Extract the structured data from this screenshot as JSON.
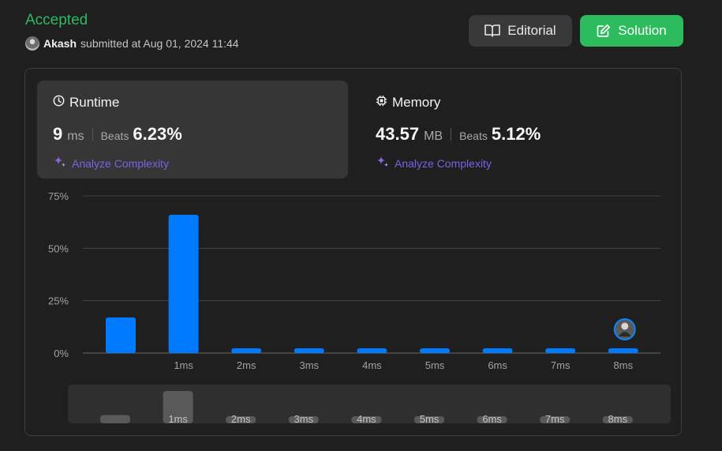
{
  "status": "Accepted",
  "submitter": {
    "name": "Akash",
    "submitted_text": "submitted at Aug 01, 2024 11:44"
  },
  "buttons": {
    "editorial": "Editorial",
    "solution": "Solution"
  },
  "runtime": {
    "title": "Runtime",
    "value": "9",
    "unit": "ms",
    "beats_label": "Beats",
    "beats_value": "6.23%",
    "analyze_label": "Analyze Complexity",
    "icon": "clock-icon"
  },
  "memory": {
    "title": "Memory",
    "value": "43.57",
    "unit": "MB",
    "beats_label": "Beats",
    "beats_value": "5.12%",
    "analyze_label": "Analyze Complexity",
    "icon": "chip-icon"
  },
  "colors": {
    "accepted": "#2cbb5d",
    "bar": "#007aff",
    "analyze": "#7f5fe6",
    "mini_bar": "#595959"
  },
  "chart_data": {
    "type": "bar",
    "categories": [
      "",
      "1ms",
      "2ms",
      "3ms",
      "4ms",
      "5ms",
      "6ms",
      "7ms",
      "8ms"
    ],
    "values": [
      17,
      66,
      2,
      2,
      2,
      2,
      2,
      2,
      2
    ],
    "yticks": [
      "0%",
      "25%",
      "50%",
      "75%"
    ],
    "ytick_values": [
      0,
      25,
      50,
      75
    ],
    "ylim": [
      0,
      75
    ],
    "grid": true,
    "user_marker_category": "8ms",
    "xlabel": "",
    "ylabel": "",
    "overview": {
      "categories": [
        "",
        "1ms",
        "2ms",
        "3ms",
        "4ms",
        "5ms",
        "6ms",
        "7ms",
        "8ms"
      ],
      "values": [
        17,
        66,
        2,
        2,
        2,
        2,
        2,
        2,
        2
      ]
    }
  }
}
